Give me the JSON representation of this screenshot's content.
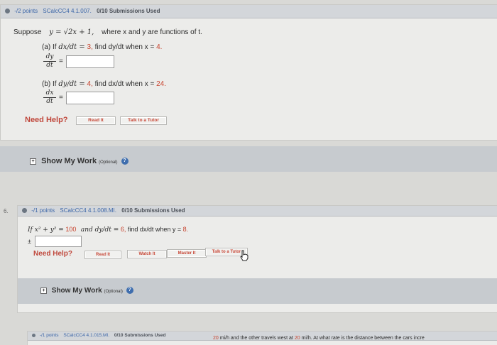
{
  "q1": {
    "header": {
      "points": "-/2 points",
      "source": "SCalcCC4 4.1.007.",
      "submissions": "0/10 Submissions Used"
    },
    "prompt_lead": "Suppose",
    "equation": "y = √2x + 1,",
    "prompt_tail": "where x and y are functions of t.",
    "part_a": {
      "label": "(a) If",
      "given": "dx/dt =",
      "given_value": "3,",
      "find": "find dy/dt when x =",
      "when_value": "4.",
      "frac_num": "dy",
      "frac_den": "dt",
      "answer": ""
    },
    "part_b": {
      "label": "(b) If",
      "given": "dy/dt =",
      "given_value": "4,",
      "find": "find dx/dt when x =",
      "when_value": "24.",
      "frac_num": "dx",
      "frac_den": "dt",
      "answer": ""
    },
    "need_help": "Need Help?",
    "buttons": {
      "read_it": "Read It",
      "talk_tutor": "Talk to a Tutor"
    },
    "show_work": {
      "label": "Show My Work",
      "optional": "(Optional)"
    }
  },
  "q2": {
    "number": "6.",
    "header": {
      "points": "-/1 points",
      "source": "SCalcCC4 4.1.008.MI.",
      "submissions": "0/10 Submissions Used"
    },
    "prompt_a": "If x² + y² =",
    "prompt_val1": "100",
    "prompt_b": "and dy/dt =",
    "prompt_val2": "6,",
    "prompt_c": "find dx/dt when y =",
    "prompt_val3": "8.",
    "pm": "±",
    "answer": "",
    "need_help": "Need Help?",
    "buttons": {
      "read_it": "Read It",
      "watch_it": "Watch It",
      "master_it": "Master It",
      "talk_tutor": "Talk to a Tutor"
    },
    "show_work": {
      "label": "Show My Work",
      "optional": "(Optional)"
    }
  },
  "q3": {
    "header": {
      "points": "-/1 points",
      "source": "SCalcCC4 4.1.015.MI.",
      "submissions": "0/10 Submissions Used"
    },
    "prompt_val": "20",
    "prompt_fragment": "mi/h and the other travels west at",
    "prompt_tail": "mi/h. At what rate is the distance between the cars incre"
  }
}
